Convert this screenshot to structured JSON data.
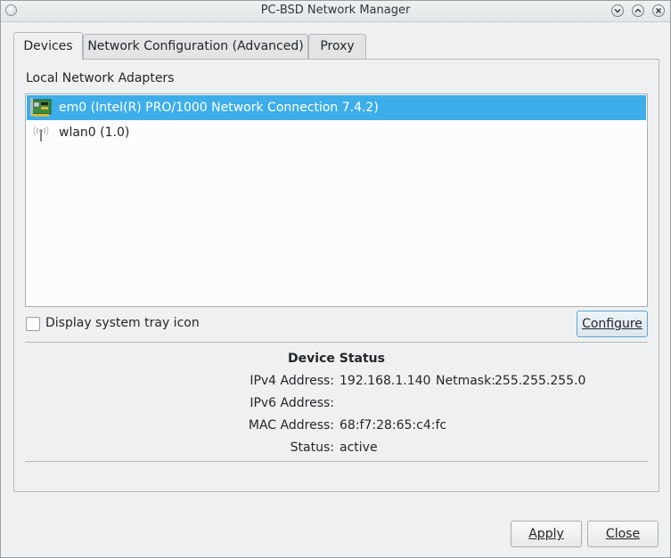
{
  "window": {
    "title": "PC-BSD Network Manager",
    "controls": [
      "minimize",
      "maximize",
      "close"
    ]
  },
  "tabs": [
    {
      "label": "Devices",
      "active": true
    },
    {
      "label": "Network Configuration (Advanced)",
      "active": false
    },
    {
      "label": "Proxy",
      "active": false
    }
  ],
  "devices": {
    "section_label": "Local Network Adapters",
    "adapters": [
      {
        "label": "em0 (Intel(R) PRO/1000 Network Connection 7.4.2)",
        "icon": "network-card-icon",
        "selected": true
      },
      {
        "label": "wlan0 (1.0)",
        "icon": "wireless-antenna-icon",
        "selected": false
      }
    ],
    "tray_checkbox_label": "Display system tray icon",
    "tray_checked": false,
    "configure_label": "Configure"
  },
  "status": {
    "title": "Device Status",
    "ipv4_label": "IPv4 Address:",
    "ipv4_value": "192.168.1.140",
    "netmask_label": "Netmask:",
    "netmask_value": "255.255.255.0",
    "ipv6_label": "IPv6 Address:",
    "ipv6_value": "",
    "mac_label": "MAC Address:",
    "mac_value": "68:f7:28:65:c4:fc",
    "status_label": "Status:",
    "status_value": "active"
  },
  "footer": {
    "apply_label": "Apply",
    "close_label": "Close"
  },
  "colors": {
    "selection": "#3daee9",
    "window_bg": "#eff0f1"
  }
}
